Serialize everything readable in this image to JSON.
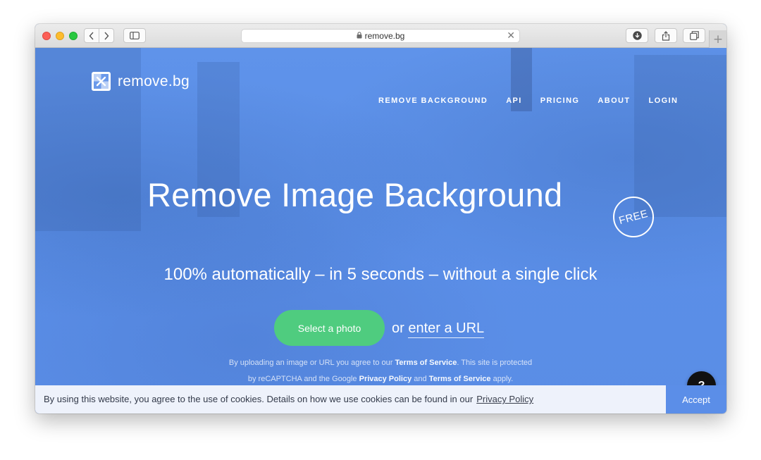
{
  "browser": {
    "url": "remove.bg",
    "new_tab_symbol": "+"
  },
  "site": {
    "logo_text": "remove.bg",
    "nav": [
      {
        "label": "REMOVE BACKGROUND"
      },
      {
        "label": "API"
      },
      {
        "label": "PRICING"
      },
      {
        "label": "ABOUT"
      },
      {
        "label": "LOGIN"
      }
    ]
  },
  "hero": {
    "title": "Remove Image Background",
    "badge": "FREE",
    "subtitle": "100% automatically – in 5 seconds – without a single click",
    "select_button": "Select a photo",
    "or_text": "or ",
    "url_link": "enter a URL"
  },
  "legal": {
    "line1_a": "By uploading an image or URL you agree to our ",
    "line1_link": "Terms of Service",
    "line1_b": ". This site is protected",
    "line2_a": "by reCAPTCHA and the Google ",
    "line2_link1": "Privacy Policy",
    "line2_b": " and ",
    "line2_link2": "Terms of Service",
    "line2_c": " apply."
  },
  "help": {
    "label": "?"
  },
  "cookie": {
    "text": "By using this website, you agree to the use of cookies. Details on how we use cookies can be found in our",
    "link": "Privacy Policy",
    "accept": "Accept"
  },
  "colors": {
    "brand_blue": "#5b8ee8",
    "button_green": "#4fcc7f",
    "cookie_bg": "#eef2fb"
  },
  "icons": {
    "close_url": "close-icon",
    "lock": "lock-icon",
    "logo": "remove-bg-logo-icon"
  }
}
